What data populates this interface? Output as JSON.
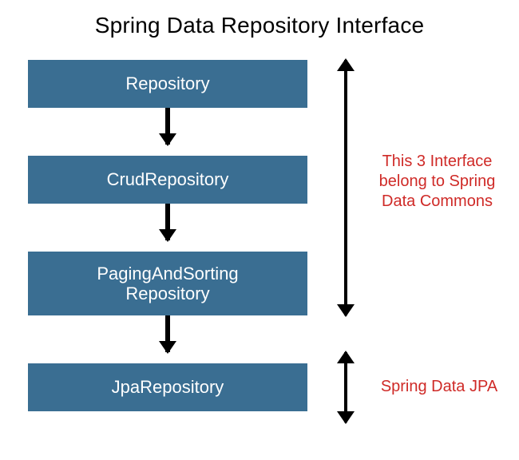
{
  "title": "Spring Data Repository Interface",
  "boxes": [
    {
      "lines": [
        "Repository"
      ]
    },
    {
      "lines": [
        "CrudRepository"
      ]
    },
    {
      "lines": [
        "PagingAndSorting",
        "Repository"
      ]
    },
    {
      "lines": [
        "JpaRepository"
      ]
    }
  ],
  "annotations": {
    "commons": "This 3 Interface belong to Spring Data Commons",
    "jpa": "Spring Data JPA"
  },
  "colors": {
    "box_bg": "#3a6e92",
    "box_fg": "#ffffff",
    "annotation": "#cf2a27"
  }
}
